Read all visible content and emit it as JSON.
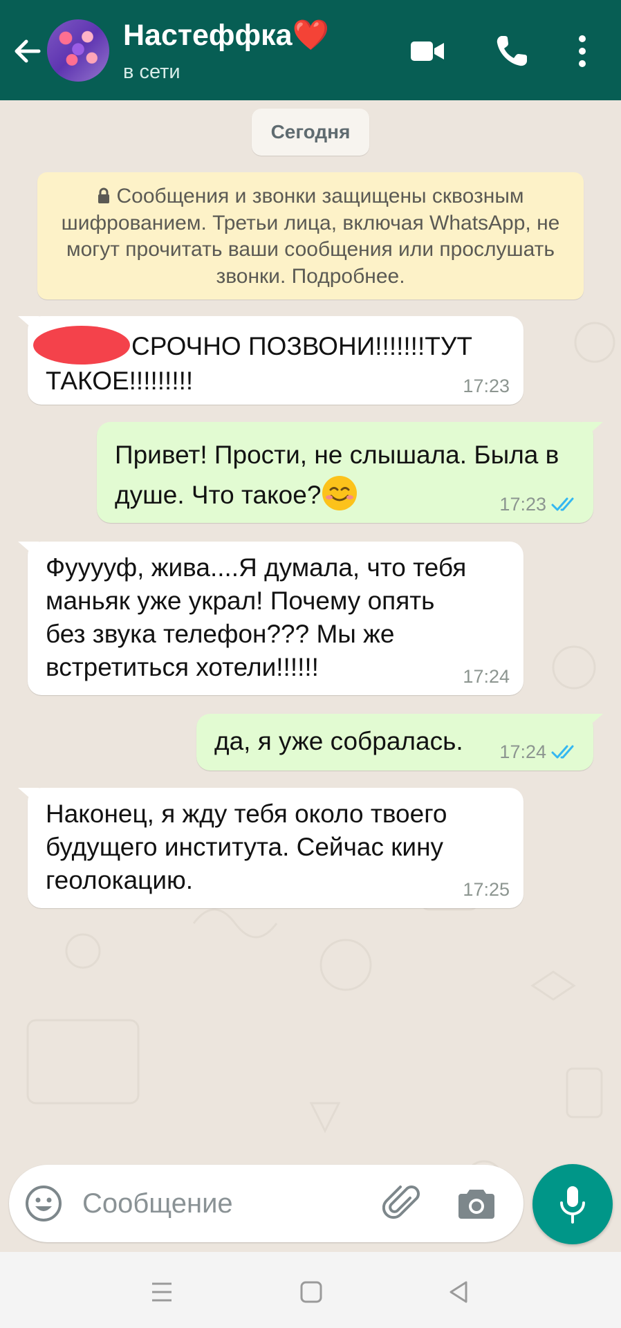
{
  "header": {
    "contact_name": "Настеффка",
    "heart": "❤️",
    "status": "в сети",
    "icons": [
      "back-arrow-icon",
      "video-call-icon",
      "phone-icon",
      "more-vert-icon"
    ],
    "color": "#075e54"
  },
  "chat": {
    "date_label": "Сегодня",
    "encryption_notice": "Сообщения и звонки защищены сквозным шифрованием. Третьи лица, включая WhatsApp, не могут прочитать ваши сообщения или прослушать звонки. Подробнее.",
    "messages": [
      {
        "direction": "in",
        "text": "СРОЧНО ПОЗВОНИ!!!!!!!ТУТ ТАКОЕ!!!!!!!!!",
        "time": "17:23",
        "redacted_prefix": true
      },
      {
        "direction": "out",
        "text": "Привет! Прости, не слышала. Была в душе. Что такое?",
        "emoji": "☺️",
        "time": "17:23",
        "status": "read"
      },
      {
        "direction": "in",
        "text": "Фууууф, жива....Я думала, что тебя маньяк уже украл! Почему опять без звука телефон??? Мы же встретиться хотели!!!!!!",
        "time": "17:24"
      },
      {
        "direction": "out",
        "text": "да, я уже собралась.",
        "time": "17:24",
        "status": "read"
      },
      {
        "direction": "in",
        "text": "Наконец, я жду тебя около твоего будущего института. Сейчас кину геолокацию.",
        "time": "17:25"
      }
    ]
  },
  "composer": {
    "placeholder": "Сообщение",
    "icons": [
      "emoji-icon",
      "paperclip-icon",
      "camera-icon",
      "mic-icon"
    ],
    "accent": "#009688"
  },
  "navbar": {
    "icons": [
      "menu-icon",
      "home-icon",
      "back-triangle-icon"
    ]
  },
  "colors": {
    "incoming_bubble": "#ffffff",
    "outgoing_bubble": "#e2fbd2",
    "read_ticks": "#34b7f1"
  }
}
